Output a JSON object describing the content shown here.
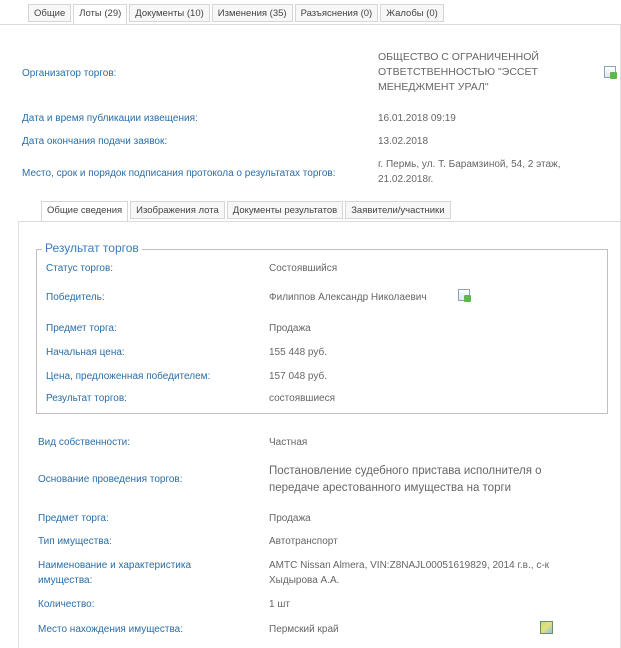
{
  "outer_tabs": [
    {
      "label": "Общие"
    },
    {
      "label": "Лоты (29)"
    },
    {
      "label": "Документы (10)"
    },
    {
      "label": "Изменения (35)"
    },
    {
      "label": "Разъяснения (0)"
    },
    {
      "label": "Жалобы (0)"
    }
  ],
  "organizer": {
    "label": "Организатор торгов:",
    "value_lines": [
      "ОБЩЕСТВО С ОГРАНИЧЕННОЙ",
      "ОТВЕТСТВЕННОСТЬЮ \"ЭССЕТ",
      "МЕНЕДЖМЕНТ УРАЛ\""
    ]
  },
  "publication": {
    "label": "Дата и время публикации извещения:",
    "value": "16.01.2018 09:19"
  },
  "deadline": {
    "label": "Дата окончания подачи заявок:",
    "value": "13.02.2018"
  },
  "protocol": {
    "label": "Место, срок и порядок подписания протокола о результатах торгов:",
    "value_lines": [
      "г. Пермь, ул. Т. Барамзиной, 54, 2 этаж,",
      "21.02.2018г."
    ]
  },
  "inner_tabs": [
    {
      "label": "Общие сведения"
    },
    {
      "label": "Изображения лота"
    },
    {
      "label": "Документы результатов"
    },
    {
      "label": "Заявители/участники"
    }
  ],
  "result": {
    "legend": "Результат торгов",
    "rows": [
      {
        "label": "Статус торгов:",
        "value": "Состоявшийся"
      },
      {
        "label": "Победитель:",
        "value": "Филиппов Александр Николаевич"
      },
      {
        "label": "Предмет торга:",
        "value": "Продажа"
      },
      {
        "label": "Начальная цена:",
        "value": "155 448 руб."
      },
      {
        "label": "Цена, предложенная победителем:",
        "value": "157 048 руб."
      },
      {
        "label": "Результат торгов:",
        "value": "состоявшиеся"
      }
    ]
  },
  "details": {
    "ownership": {
      "label": "Вид собственности:",
      "value": "Частная"
    },
    "basis": {
      "label": "Основание проведения торгов:",
      "value_lines": [
        "Постановление судебного пристава исполнителя о",
        "передаче арестованного имущества на торги"
      ]
    },
    "subject": {
      "label": "Предмет торга:",
      "value": "Продажа"
    },
    "property_type": {
      "label": "Тип имущества:",
      "value": "Автотранспорт"
    },
    "name": {
      "label_lines": [
        "Наименование и характеристика",
        "имущества:"
      ],
      "value_lines": [
        "АМТС Nissan Almera, VIN:Z8NAJL00051619829, 2014 г.в., с-к",
        "Хыдырова А.А."
      ]
    },
    "quantity": {
      "label": "Количество:",
      "value": "1 шт"
    },
    "location": {
      "label": "Место нахождения имущества:",
      "value": "Пермский край"
    }
  }
}
